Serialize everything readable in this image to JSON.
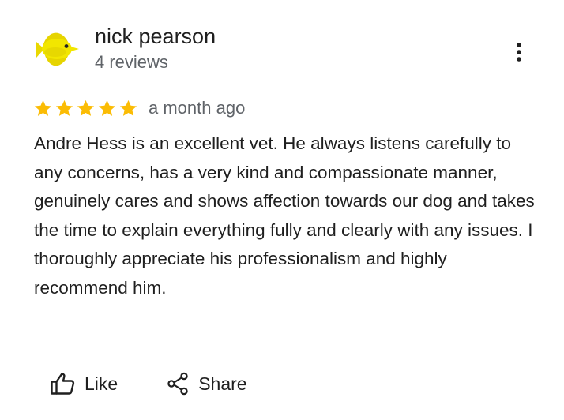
{
  "review": {
    "author_name": "nick pearson",
    "author_meta": "4 reviews",
    "rating": 5,
    "rating_max": 5,
    "time_ago": "a month ago",
    "text": "Andre Hess is an excellent vet. He always listens carefully to any concerns, has a very kind and compassionate manner, genuinely cares and shows affection towards our dog and takes the time to explain everything fully and clearly with any issues. I thoroughly appreciate his professionalism and highly recommend him."
  },
  "actions": {
    "like_label": "Like",
    "share_label": "Share"
  },
  "icons": {
    "avatar": "yellow-tang-fish-avatar",
    "more": "more-vert-icon",
    "star": "star-icon",
    "like": "thumb-up-icon",
    "share": "share-icon"
  },
  "colors": {
    "star": "#fbbc04",
    "text_primary": "#1f1f1f",
    "text_secondary": "#5f6368",
    "avatar_fish": "#f2e600"
  }
}
